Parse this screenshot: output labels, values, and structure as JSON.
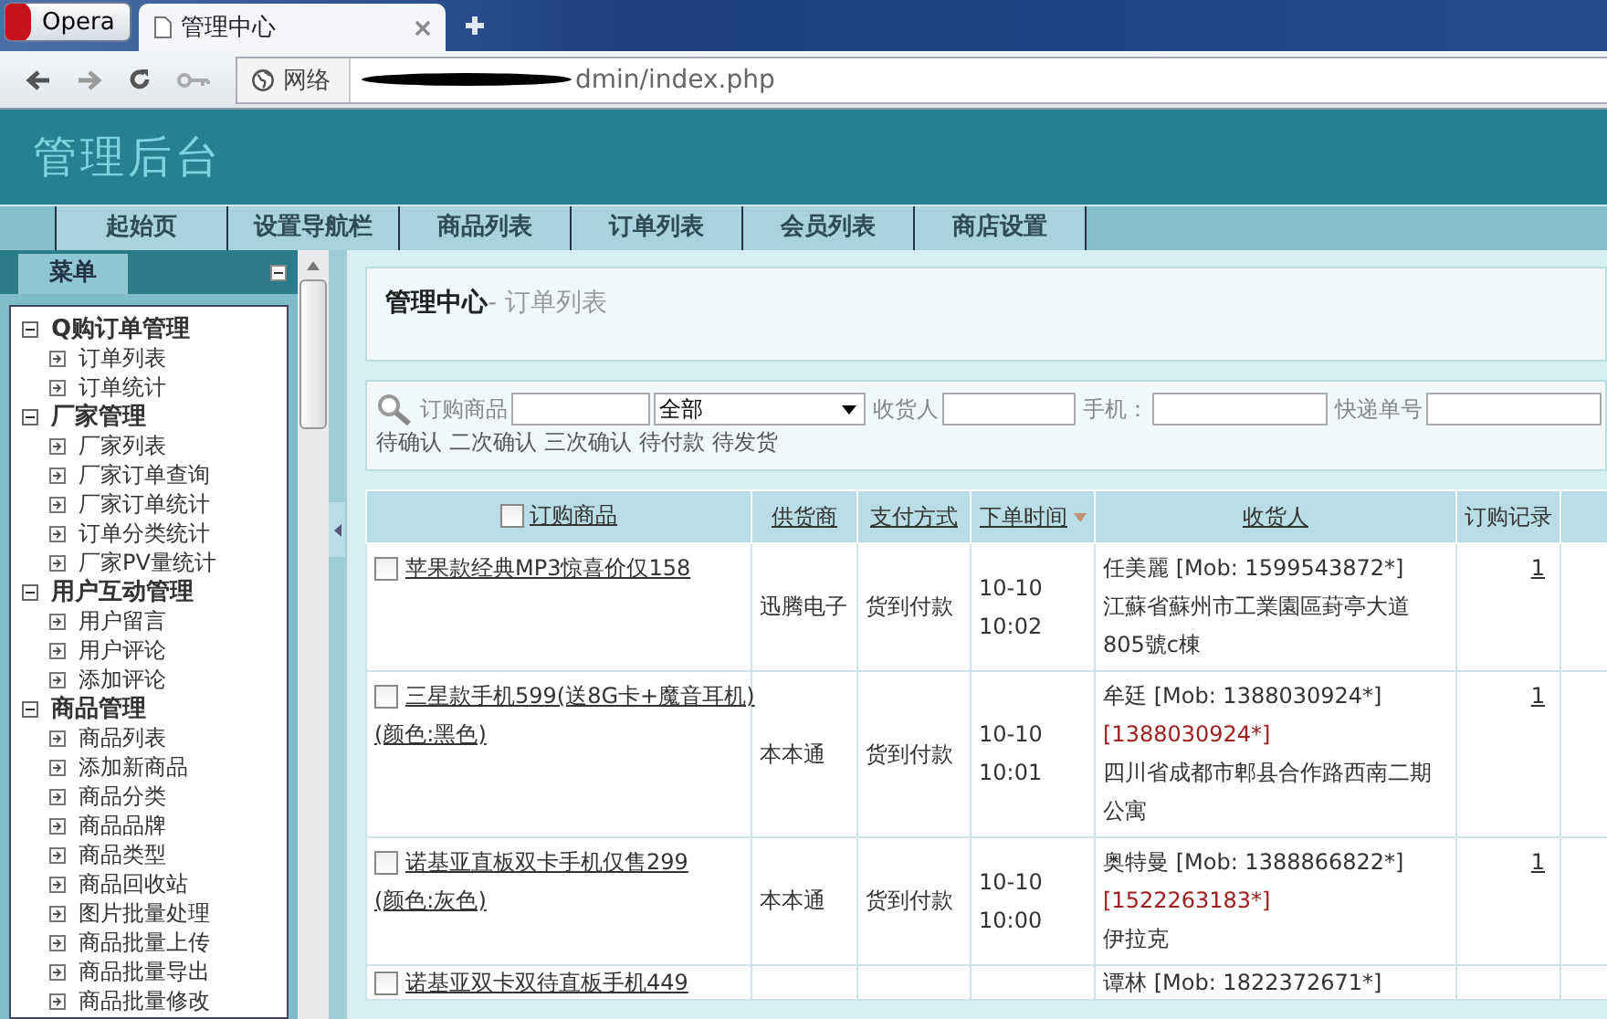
{
  "browser": {
    "menu_button": "Opera",
    "tab": {
      "title": "管理中心"
    },
    "address": {
      "zone": "网络",
      "url": "dmin/index.php"
    }
  },
  "header": {
    "title": "管理后台"
  },
  "nav": [
    {
      "label": "起始页"
    },
    {
      "label": "设置导航栏"
    },
    {
      "label": "商品列表"
    },
    {
      "label": "订单列表"
    },
    {
      "label": "会员列表"
    },
    {
      "label": "商店设置"
    }
  ],
  "sidebar": {
    "title": "菜单",
    "groups": [
      {
        "label": "Q购订单管理",
        "expanded": true,
        "children": [
          {
            "label": "订单列表"
          },
          {
            "label": "订单统计"
          }
        ]
      },
      {
        "label": "厂家管理",
        "expanded": true,
        "children": [
          {
            "label": "厂家列表"
          },
          {
            "label": "厂家订单查询"
          },
          {
            "label": "厂家订单统计"
          },
          {
            "label": "订单分类统计"
          },
          {
            "label": "厂家PV量统计"
          }
        ]
      },
      {
        "label": "用户互动管理",
        "expanded": true,
        "children": [
          {
            "label": "用户留言"
          },
          {
            "label": "用户评论"
          },
          {
            "label": "添加评论"
          }
        ]
      },
      {
        "label": "商品管理",
        "expanded": true,
        "children": [
          {
            "label": "商品列表"
          },
          {
            "label": "添加新商品"
          },
          {
            "label": "商品分类"
          },
          {
            "label": "商品品牌"
          },
          {
            "label": "商品类型"
          },
          {
            "label": "商品回收站"
          },
          {
            "label": "图片批量处理"
          },
          {
            "label": "商品批量上传"
          },
          {
            "label": "商品批量导出"
          },
          {
            "label": "商品批量修改"
          }
        ]
      }
    ]
  },
  "breadcrumb": {
    "title": "管理中心",
    "subtitle": "- 订单列表"
  },
  "filters": [
    {
      "kind": "input",
      "label": "订购商品"
    },
    {
      "kind": "select",
      "value": "全部"
    },
    {
      "kind": "input",
      "label": "收货人"
    },
    {
      "kind": "input",
      "label": "手机："
    },
    {
      "kind": "input",
      "label": "快递单号"
    }
  ],
  "status_links": [
    "待确认",
    "二次确认",
    "三次确认",
    "待付款",
    "待发货"
  ],
  "table": {
    "columns": [
      {
        "label": "订购商品",
        "checkbox": true,
        "link": true,
        "sorted": false
      },
      {
        "label": "供货商",
        "checkbox": false,
        "link": true,
        "sorted": false
      },
      {
        "label": "支付方式",
        "checkbox": false,
        "link": true,
        "sorted": false
      },
      {
        "label": "下单时间",
        "checkbox": false,
        "link": true,
        "sorted": true
      },
      {
        "label": "收货人",
        "checkbox": false,
        "link": true,
        "sorted": false
      },
      {
        "label": "订购记录",
        "checkbox": false,
        "link": false,
        "sorted": false
      }
    ],
    "header_checked": false,
    "rows": [
      {
        "checked": false,
        "product": "苹果款经典MP3惊喜价仅158",
        "variant": "",
        "supplier": "迅腾电子",
        "payment": "货到付款",
        "date": "10-10",
        "time": "10:02",
        "name": "任美麗",
        "mob": "[Mob: 1599543872*]",
        "alt_phone": "",
        "address": "江蘇省蘇州市工業園區葑亭大道805號c棟",
        "record": "1"
      },
      {
        "checked": false,
        "product": "三星款手机599(送8G卡+魔音耳机)",
        "variant": "(颜色:黑色)",
        "supplier": "本本通",
        "payment": "货到付款",
        "date": "10-10",
        "time": "10:01",
        "name": "牟廷",
        "mob": "[Mob: 1388030924*]",
        "alt_phone": "[1388030924*]",
        "address": "四川省成都市郫县合作路西南二期公寓",
        "record": "1"
      },
      {
        "checked": false,
        "product": "诺基亚直板双卡手机仅售299",
        "variant": "(颜色:灰色)",
        "supplier": "本本通",
        "payment": "货到付款",
        "date": "10-10",
        "time": "10:00",
        "name": "奥特曼",
        "mob": "[Mob: 1388866822*]",
        "alt_phone": "[1522263183*]",
        "address": "伊拉克",
        "record": "1"
      },
      {
        "checked": false,
        "product": "诺基亚双卡双待直板手机449",
        "variant": "",
        "supplier": "",
        "payment": "",
        "date": "",
        "time": "",
        "name": "谭林",
        "mob": "[Mob: 1822372671*]",
        "alt_phone": "",
        "address": "",
        "record": ""
      }
    ]
  }
}
